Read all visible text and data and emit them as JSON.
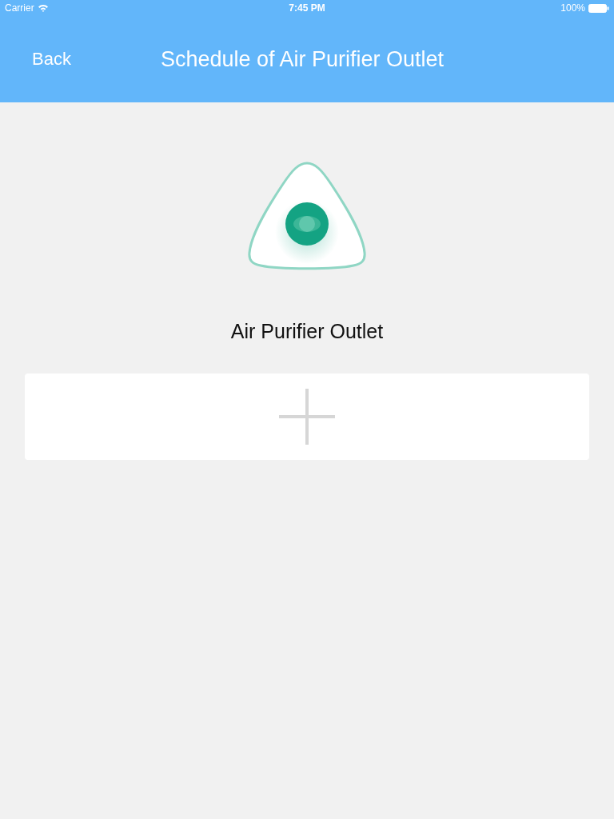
{
  "status_bar": {
    "carrier": "Carrier",
    "time": "7:45 PM",
    "battery": "100%"
  },
  "nav_bar": {
    "back": "Back",
    "title": "Schedule of Air Purifier Outlet"
  },
  "device": {
    "name": "Air Purifier Outlet"
  }
}
